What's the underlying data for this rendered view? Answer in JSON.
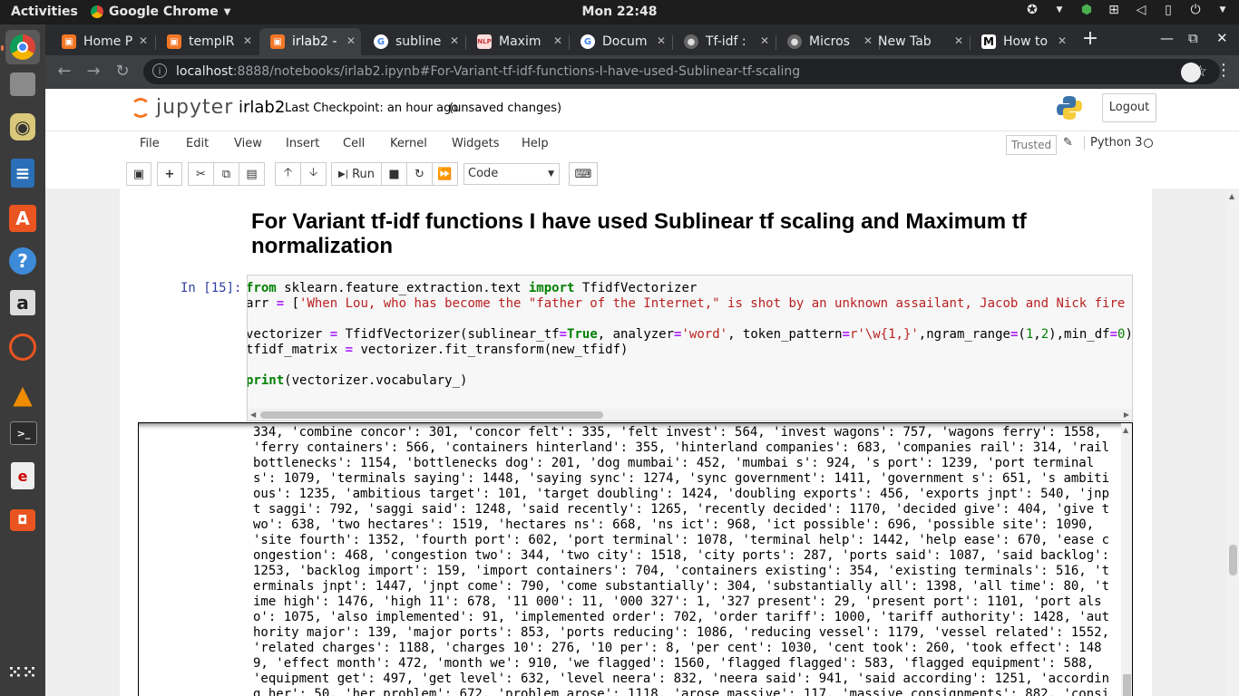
{
  "system": {
    "activities": "Activities",
    "app_menu": "Google Chrome",
    "clock": "Mon 22:48"
  },
  "dock": {
    "items": [
      "chrome-icon",
      "files-icon",
      "rhythmbox-icon",
      "writer-icon",
      "software-icon",
      "help-icon",
      "amazon-icon",
      "update-icon",
      "vlc-icon",
      "terminal-icon",
      "docviewer-icon",
      "screenshot-icon",
      "app-grid-icon"
    ]
  },
  "browser": {
    "tabs": [
      {
        "label": "Home P"
      },
      {
        "label": "tempIR"
      },
      {
        "label": "irlab2 -"
      },
      {
        "label": "subline"
      },
      {
        "label": "Maxim"
      },
      {
        "label": "Docum"
      },
      {
        "label": "Tf-idf :"
      },
      {
        "label": "Micros"
      },
      {
        "label": "New Tab"
      },
      {
        "label": "How to"
      }
    ],
    "url_host": "localhost",
    "url_rest": ":8888/notebooks/irlab2.ipynb#For-Variant-tf-idf-functions-I-have-used-Sublinear-tf-scaling"
  },
  "jupyter": {
    "logo_text": "jupyter",
    "notebook_name": "irlab2",
    "checkpoint": "Last Checkpoint: an hour ago",
    "unsaved": "(unsaved changes)",
    "logout": "Logout",
    "menus": [
      "File",
      "Edit",
      "View",
      "Insert",
      "Cell",
      "Kernel",
      "Widgets",
      "Help"
    ],
    "trusted": "Trusted",
    "kernel": "Python 3",
    "run_label": "Run",
    "cell_type": "Code"
  },
  "notebook": {
    "heading": "For Variant tf-idf functions I have used Sublinear tf scaling and Maximum tf normalization",
    "prompt": "In [15]:",
    "output_lines": [
      "334, 'combine concor': 301, 'concor felt': 335, 'felt invest': 564, 'invest wagons': 757, 'wagons ferry': 1558,",
      "'ferry containers': 566, 'containers hinterland': 355, 'hinterland companies': 683, 'companies rail': 314, 'rail",
      "bottlenecks': 1154, 'bottlenecks dog': 201, 'dog mumbai': 452, 'mumbai s': 924, 's port': 1239, 'port terminal",
      "s': 1079, 'terminals saying': 1448, 'saying sync': 1274, 'sync government': 1411, 'government s': 651, 's ambiti",
      "ous': 1235, 'ambitious target': 101, 'target doubling': 1424, 'doubling exports': 456, 'exports jnpt': 540, 'jnp",
      "t saggi': 792, 'saggi said': 1248, 'said recently': 1265, 'recently decided': 1170, 'decided give': 404, 'give t",
      "wo': 638, 'two hectares': 1519, 'hectares ns': 668, 'ns ict': 968, 'ict possible': 696, 'possible site': 1090,",
      "'site fourth': 1352, 'fourth port': 602, 'port terminal': 1078, 'terminal help': 1442, 'help ease': 670, 'ease c",
      "ongestion': 468, 'congestion two': 344, 'two city': 1518, 'city ports': 287, 'ports said': 1087, 'said backlog':",
      "1253, 'backlog import': 159, 'import containers': 704, 'containers existing': 354, 'existing terminals': 516, 't",
      "erminals jnpt': 1447, 'jnpt come': 790, 'come substantially': 304, 'substantially all': 1398, 'all time': 80, 't",
      "ime high': 1476, 'high 11': 678, '11 000': 11, '000 327': 1, '327 present': 29, 'present port': 1101, 'port als",
      "o': 1075, 'also implemented': 91, 'implemented order': 702, 'order tariff': 1000, 'tariff authority': 1428, 'aut",
      "hority major': 139, 'major ports': 853, 'ports reducing': 1086, 'reducing vessel': 1179, 'vessel related': 1552,",
      "'related charges': 1188, 'charges 10': 276, '10 per': 8, 'per cent': 1030, 'cent took': 260, 'took effect': 148",
      "9, 'effect month': 472, 'month we': 910, 'we flagged': 1560, 'flagged flagged': 583, 'flagged equipment': 588,",
      "'equipment get': 497, 'get level': 632, 'level neera': 832, 'neera said': 941, 'said according': 1251, 'accordin",
      "g her': 50, 'her problem': 672, 'problem arose': 1118, 'arose massive': 117, 'massive consignments': 882, 'consi"
    ]
  }
}
